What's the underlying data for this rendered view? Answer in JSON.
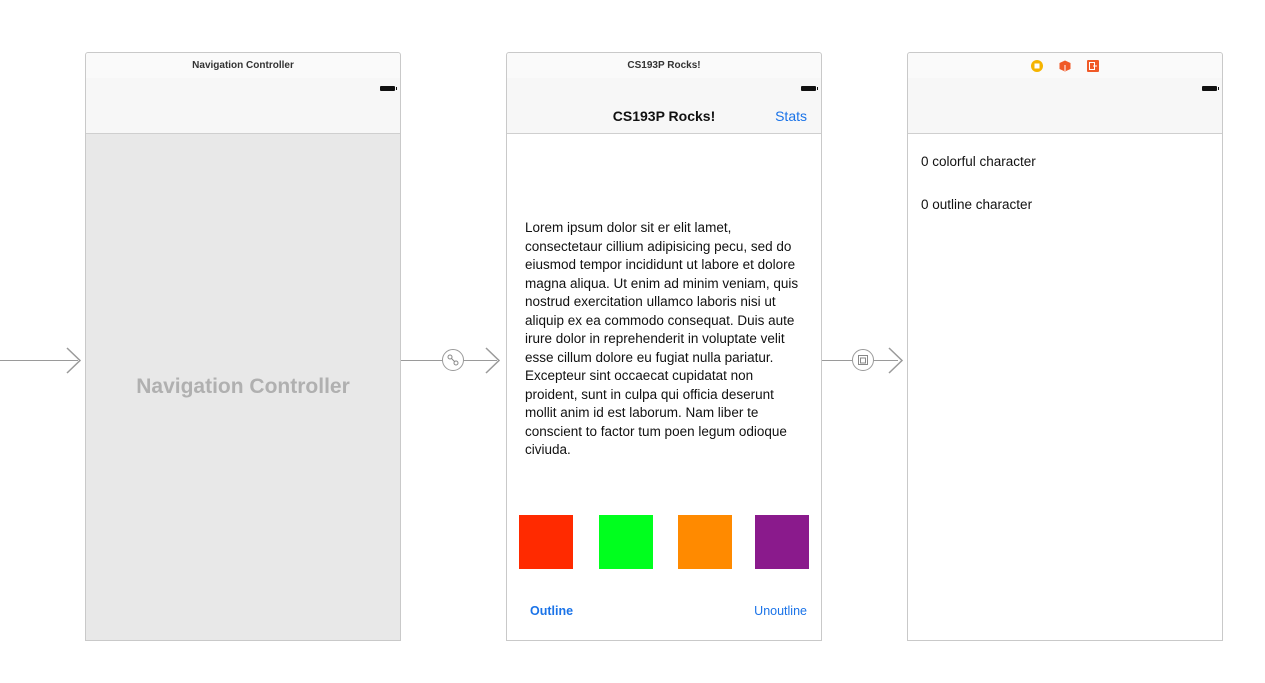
{
  "scenes": {
    "navigation_controller": {
      "title": "Navigation Controller",
      "placeholder_label": "Navigation Controller"
    },
    "main": {
      "title": "CS193P Rocks!",
      "nav_title": "CS193P Rocks!",
      "nav_right_button": "Stats",
      "body_text": "Lorem ipsum dolor sit er elit lamet, consectetaur cillium adipisicing pecu, sed do eiusmod tempor incididunt ut labore et dolore magna aliqua. Ut enim ad minim veniam, quis nostrud exercitation ullamco laboris nisi ut aliquip ex ea commodo consequat. Duis aute irure dolor in reprehenderit in voluptate velit esse cillum dolore eu fugiat nulla pariatur. Excepteur sint occaecat cupidatat non proident, sunt in culpa qui officia deserunt mollit anim id est laborum. Nam liber te conscient to factor tum poen legum odioque civiuda.",
      "swatches": [
        "#ff2a00",
        "#00ff1e",
        "#ff8a00",
        "#8a1a8c"
      ],
      "outline_button": "Outline",
      "unoutline_button": "Unoutline"
    },
    "stats": {
      "header_icons": [
        "view-controller-icon",
        "first-responder-icon",
        "exit-icon"
      ],
      "colorful_label": "0 colorful character",
      "outline_label": "0 outline character"
    }
  },
  "segues": [
    "relationship-segue-icon",
    "show-segue-icon"
  ],
  "accent_color": "#1a73e8"
}
